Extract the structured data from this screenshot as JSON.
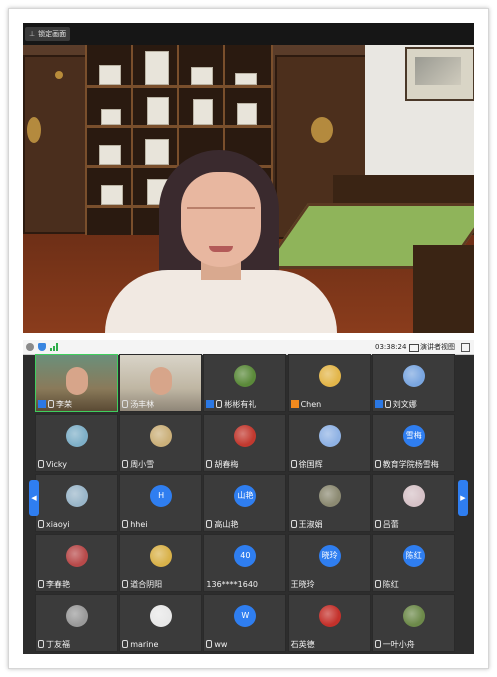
{
  "speaker": {
    "lock_label": "锁定画面"
  },
  "toolbar": {
    "timer": "03:38:24",
    "view_label": "演讲者视图"
  },
  "participants": [
    {
      "name": "李荣",
      "kind": "video",
      "badge": "host",
      "avatar_color": "#6b8fa8"
    },
    {
      "name": "汤丰林",
      "kind": "video",
      "badge": "mic",
      "avatar_color": "#c9c2b4"
    },
    {
      "name": "彬彬有礼",
      "kind": "photo",
      "badge": "host",
      "avatar_color": "#5b8a3a"
    },
    {
      "name": "Chen",
      "kind": "photo",
      "badge": "cohost",
      "avatar_color": "#e3b64a"
    },
    {
      "name": "刘文娜",
      "kind": "photo",
      "badge": "host",
      "avatar_color": "#7aa6e0"
    },
    {
      "name": "Vicky",
      "kind": "photo",
      "badge": "mic",
      "avatar_color": "#7fb0c8"
    },
    {
      "name": "周小雪",
      "kind": "photo",
      "badge": "mic",
      "avatar_color": "#cbb07a"
    },
    {
      "name": "胡春梅",
      "kind": "photo",
      "badge": "mic",
      "avatar_color": "#c2392f"
    },
    {
      "name": "徐国辉",
      "kind": "photo",
      "badge": "mic",
      "avatar_color": "#8fb2e4"
    },
    {
      "name": "教育学院杨雪梅",
      "kind": "text",
      "badge": "mic",
      "avatar_text": "雪梅"
    },
    {
      "name": "xiaoyi",
      "kind": "photo",
      "badge": "mic",
      "avatar_color": "#9ab6c9"
    },
    {
      "name": "hhei",
      "kind": "text",
      "badge": "mic",
      "avatar_text": "H"
    },
    {
      "name": "高山艳",
      "kind": "text",
      "badge": "mic",
      "avatar_text": "山艳"
    },
    {
      "name": "王淑娟",
      "kind": "photo",
      "badge": "mic",
      "avatar_color": "#8c8a72"
    },
    {
      "name": "吕蕾",
      "kind": "photo",
      "badge": "mic",
      "avatar_color": "#d6c2c7"
    },
    {
      "name": "李春艳",
      "kind": "photo",
      "badge": "mic",
      "avatar_color": "#b84a4a"
    },
    {
      "name": "道合阴阳",
      "kind": "photo",
      "badge": "mic",
      "avatar_color": "#d9b24a"
    },
    {
      "name": "136****1640",
      "kind": "text",
      "badge": "none",
      "avatar_text": "40"
    },
    {
      "name": "王晓玲",
      "kind": "text",
      "badge": "none",
      "avatar_text": "晓玲"
    },
    {
      "name": "陈红",
      "kind": "text",
      "badge": "mic",
      "avatar_text": "陈红"
    },
    {
      "name": "丁友福",
      "kind": "photo",
      "badge": "mic",
      "avatar_color": "#9a9a9a"
    },
    {
      "name": "marine",
      "kind": "photo",
      "badge": "mic",
      "avatar_color": "#e8e8e8"
    },
    {
      "name": "ww",
      "kind": "text",
      "badge": "mic",
      "avatar_text": "W"
    },
    {
      "name": "石英德",
      "kind": "photo",
      "badge": "none",
      "avatar_color": "#c4312b"
    },
    {
      "name": "一叶小舟",
      "kind": "photo",
      "badge": "mic",
      "avatar_color": "#6d8a4a"
    }
  ]
}
